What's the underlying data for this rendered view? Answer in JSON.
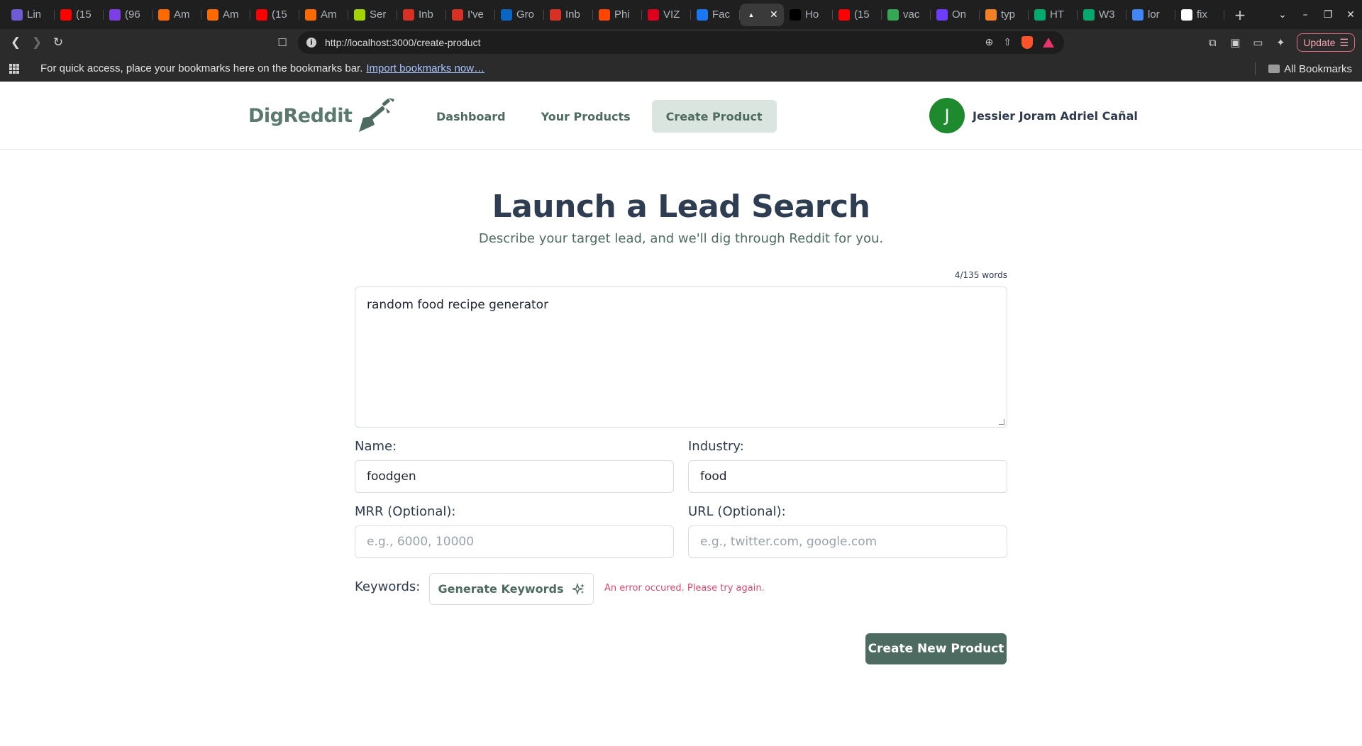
{
  "browser": {
    "tabs": [
      {
        "title": "Lin",
        "favicon_color": "#6f5bd6"
      },
      {
        "title": "(15",
        "favicon_color": "#ff0000"
      },
      {
        "title": "(96",
        "favicon_color": "#7b3fe4"
      },
      {
        "title": "Am",
        "favicon_color": "#ff6a00"
      },
      {
        "title": "Am",
        "favicon_color": "#ff6a00"
      },
      {
        "title": "(15",
        "favicon_color": "#ff0000"
      },
      {
        "title": "Am",
        "favicon_color": "#ff6a00"
      },
      {
        "title": "Ser",
        "favicon_color": "#a3d400"
      },
      {
        "title": "Inb",
        "favicon_color": "#d93025"
      },
      {
        "title": "I've",
        "favicon_color": "#d93025"
      },
      {
        "title": "Gro",
        "favicon_color": "#0a66c2"
      },
      {
        "title": "Inb",
        "favicon_color": "#d93025"
      },
      {
        "title": "Phi",
        "favicon_color": "#ff4500"
      },
      {
        "title": "VIZ",
        "favicon_color": "#e0001b"
      },
      {
        "title": "Fac",
        "favicon_color": "#1877f2"
      },
      {
        "title": "",
        "favicon_color": "#ffffff",
        "active": true
      },
      {
        "title": "Ho",
        "favicon_color": "#000000"
      },
      {
        "title": "(15",
        "favicon_color": "#ff0000"
      },
      {
        "title": "vac",
        "favicon_color": "#34a853"
      },
      {
        "title": "On",
        "favicon_color": "#6e3cff"
      },
      {
        "title": "typ",
        "favicon_color": "#f48024"
      },
      {
        "title": "HT",
        "favicon_color": "#04aa6d"
      },
      {
        "title": "W3",
        "favicon_color": "#04aa6d"
      },
      {
        "title": "lor",
        "favicon_color": "#4285f4"
      },
      {
        "title": "fix",
        "favicon_color": "#ffffff"
      }
    ],
    "url": "http://localhost:3000/create-product",
    "update_label": "Update",
    "bookmarks_prompt": "For quick access, place your bookmarks here on the bookmarks bar.",
    "import_link": "Import bookmarks now…",
    "all_bookmarks": "All Bookmarks"
  },
  "header": {
    "logo_text": "DigReddit",
    "nav": [
      "Dashboard",
      "Your Products",
      "Create Product"
    ],
    "active_nav": "Create Product",
    "user_initial": "J",
    "user_name": "Jessier Joram Adriel Cañal"
  },
  "main": {
    "title": "Launch a Lead Search",
    "subtitle": "Describe your target lead, and we'll dig through Reddit for you.",
    "word_count": "4/135 words",
    "description_value": "random food recipe generator",
    "name_label": "Name:",
    "name_value": "foodgen",
    "industry_label": "Industry:",
    "industry_value": "food",
    "mrr_label": "MRR (Optional):",
    "mrr_placeholder": "e.g., 6000, 10000",
    "url_label": "URL (Optional):",
    "url_placeholder": "e.g., twitter.com, google.com",
    "keywords_label": "Keywords:",
    "generate_keywords_label": "Generate Keywords",
    "error_message": "An error occured. Please try again.",
    "create_button": "Create New Product"
  },
  "colors": {
    "brand": "#4d6b60",
    "brand_light": "#dbe5e0",
    "error": "#e2456a",
    "avatar": "#1d8a2e"
  }
}
